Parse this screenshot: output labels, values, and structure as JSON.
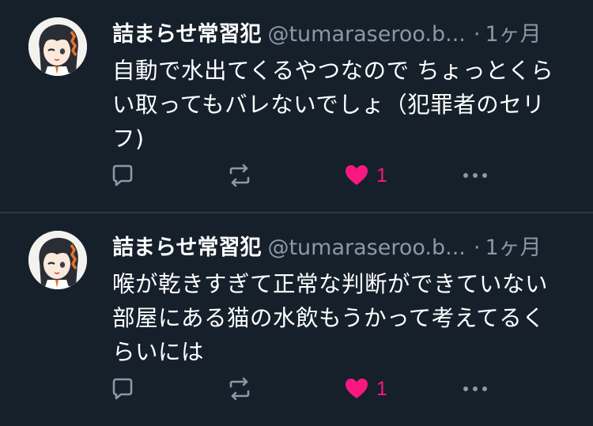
{
  "colors": {
    "background": "#15202b",
    "divider": "#2c3640",
    "secondary_text": "#8b98a5",
    "like_pink": "#f91880",
    "icon_gray": "#8b98a5"
  },
  "tweets": [
    {
      "author_name": "詰まらせ常習犯",
      "handle": "@tumaraseroo.b...",
      "separator": "·",
      "time": "1ヶ月",
      "lines": [
        "自動で水出てくるやつなので ちょっとくら",
        "い取ってもバレないでしょ（犯罪者のセリ",
        "フ)"
      ],
      "like_count": "1",
      "icons": [
        "reply-icon",
        "retweet-icon",
        "heart-icon",
        "more-icon"
      ]
    },
    {
      "author_name": "詰まらせ常習犯",
      "handle": "@tumaraseroo.b...",
      "separator": "·",
      "time": "1ヶ月",
      "lines": [
        "喉が乾きすぎて正常な判断ができていない",
        "部屋にある猫の水飲もうかって考えてるく",
        "らいには"
      ],
      "like_count": "1",
      "icons": [
        "reply-icon",
        "retweet-icon",
        "heart-icon",
        "more-icon"
      ]
    }
  ]
}
